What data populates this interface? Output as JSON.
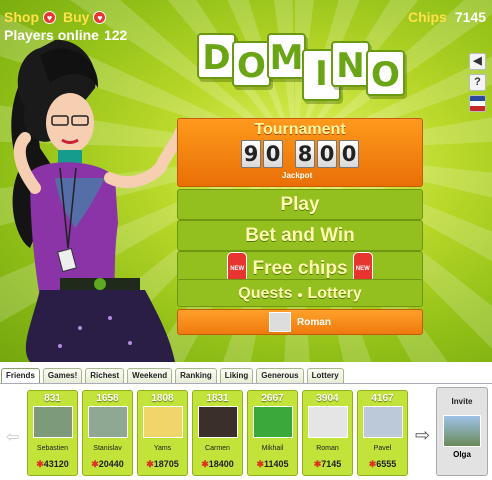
{
  "topbar": {
    "shop": "Shop",
    "buy": "Buy",
    "online_label": "Players online",
    "online_count": "122",
    "chips_label": "Chips",
    "chips_value": "7145"
  },
  "sidebar": {
    "sound": "🔊",
    "help": "?",
    "lang": "EN"
  },
  "logo": {
    "letters": [
      "D",
      "O",
      "M",
      "I",
      "N",
      "O"
    ]
  },
  "tournament": {
    "title": "Tournament",
    "digits": [
      "9",
      "0",
      "8",
      "0",
      "0"
    ],
    "jackpot": "Jackpot"
  },
  "menu": {
    "play": "Play",
    "bet": "Bet and Win",
    "free": "Free chips",
    "new": "NEW",
    "quests": "Quests",
    "dot": "●",
    "lottery": "Lottery"
  },
  "user": {
    "name": "Roman"
  },
  "tabs": [
    "Friends",
    "Games!",
    "Richest",
    "Weekend",
    "Ranking",
    "Liking",
    "Generous",
    "Lottery"
  ],
  "friends": [
    {
      "level": "831",
      "name": "Sebastien",
      "chips": "43120",
      "color": "#7d9a7a"
    },
    {
      "level": "1658",
      "name": "Stanislav",
      "chips": "20440",
      "color": "#8fa894"
    },
    {
      "level": "1808",
      "name": "Yams",
      "chips": "18705",
      "color": "#f0d66a"
    },
    {
      "level": "1831",
      "name": "Carmen",
      "chips": "18400",
      "color": "#3b2f2c"
    },
    {
      "level": "2667",
      "name": "Mikhail",
      "chips": "11405",
      "color": "#3aa83a"
    },
    {
      "level": "3904",
      "name": "Roman",
      "chips": "7145",
      "color": "#e5e5e5"
    },
    {
      "level": "4167",
      "name": "Pavel",
      "chips": "6555",
      "color": "#bcc9d9"
    }
  ],
  "invite": {
    "label": "Invite",
    "name": "Olga"
  }
}
